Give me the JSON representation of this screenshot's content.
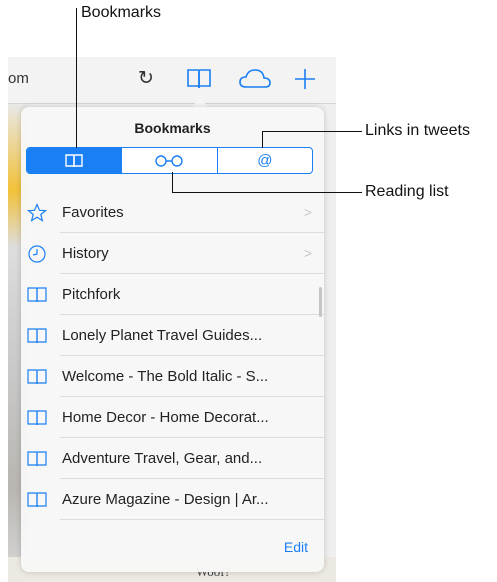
{
  "callouts": {
    "bookmarks": "Bookmarks",
    "links_in_tweets": "Links in tweets",
    "reading_list": "Reading list"
  },
  "browser": {
    "url_fragment": "om",
    "page_peek_text": "Woof?"
  },
  "popover": {
    "title": "Bookmarks",
    "tabs": [
      {
        "name": "bookmarks",
        "icon": "book-icon",
        "active": true
      },
      {
        "name": "reading-list",
        "icon": "glasses-icon",
        "active": false
      },
      {
        "name": "shared-links",
        "icon": "at-sign-icon",
        "active": false
      }
    ],
    "items": [
      {
        "label": "Favorites",
        "icon": "star-icon",
        "folder": true
      },
      {
        "label": "History",
        "icon": "clock-icon",
        "folder": true
      },
      {
        "label": "Pitchfork",
        "icon": "book-icon",
        "folder": false
      },
      {
        "label": "Lonely Planet Travel Guides...",
        "icon": "book-icon",
        "folder": false
      },
      {
        "label": "Welcome - The Bold Italic - S...",
        "icon": "book-icon",
        "folder": false
      },
      {
        "label": "Home Decor - Home Decorat...",
        "icon": "book-icon",
        "folder": false
      },
      {
        "label": "Adventure Travel, Gear, and...",
        "icon": "book-icon",
        "folder": false
      },
      {
        "label": "Azure Magazine - Design | Ar...",
        "icon": "book-icon",
        "folder": false
      }
    ],
    "edit_label": "Edit"
  },
  "colors": {
    "accent": "#1a7ff3"
  }
}
